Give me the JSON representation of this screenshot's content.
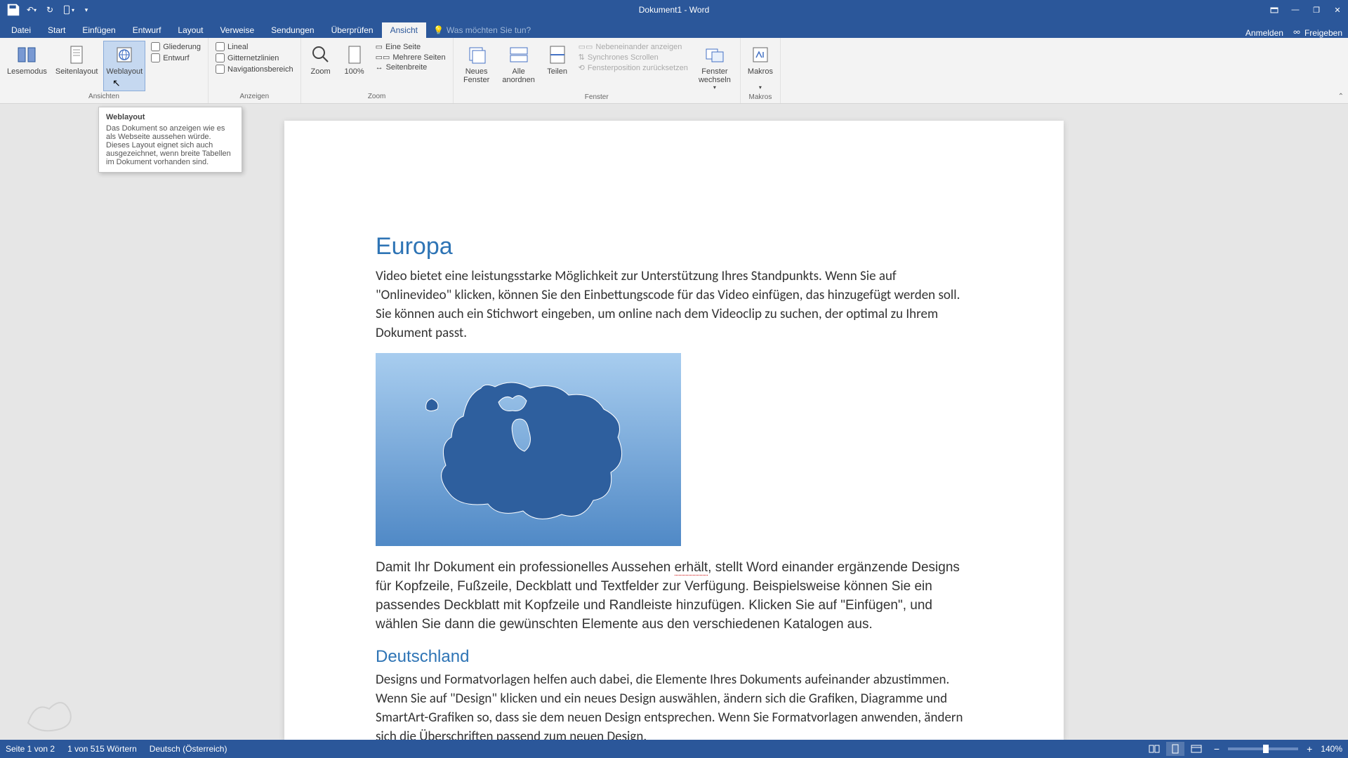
{
  "title": "Dokument1 - Word",
  "qat": {
    "save": "save",
    "undo": "undo",
    "redo": "redo"
  },
  "tabs": {
    "datei": "Datei",
    "start": "Start",
    "einfuegen": "Einfügen",
    "entwurf": "Entwurf",
    "layout": "Layout",
    "verweise": "Verweise",
    "sendungen": "Sendungen",
    "ueberpruefen": "Überprüfen",
    "ansicht": "Ansicht",
    "tellme": "Was möchten Sie tun?",
    "anmelden": "Anmelden",
    "freigeben": "Freigeben"
  },
  "ribbon": {
    "ansichten": {
      "label": "Ansichten",
      "lesemodus": "Lesemodus",
      "seitenlayout": "Seitenlayout",
      "weblayout": "Weblayout",
      "gliederung": "Gliederung",
      "entwurf": "Entwurf"
    },
    "anzeigen": {
      "label": "Anzeigen",
      "lineal": "Lineal",
      "gitternetz": "Gitternetzlinien",
      "navigation": "Navigationsbereich"
    },
    "zoom": {
      "label": "Zoom",
      "zoom": "Zoom",
      "hundred": "100%",
      "eine_seite": "Eine Seite",
      "mehrere": "Mehrere Seiten",
      "breite": "Seitenbreite"
    },
    "fenster": {
      "label": "Fenster",
      "neues": "Neues Fenster",
      "alle": "Alle anordnen",
      "teilen": "Teilen",
      "nebeneinander": "Nebeneinander anzeigen",
      "synchron": "Synchrones Scrollen",
      "position": "Fensterposition zurücksetzen",
      "wechseln": "Fenster wechseln"
    },
    "makros": {
      "label": "Makros",
      "makros": "Makros"
    }
  },
  "tooltip": {
    "title": "Weblayout",
    "body": "Das Dokument so anzeigen wie es als Webseite aussehen würde. Dieses Layout eignet sich auch ausgezeichnet, wenn breite Tabellen im Dokument vorhanden sind."
  },
  "document": {
    "h1": "Europa",
    "p1": "Video bietet eine leistungsstarke Möglichkeit zur Unterstützung Ihres Standpunkts. Wenn Sie auf \"Onlinevideo\" klicken, können Sie den Einbettungscode für das Video einfügen, das hinzugefügt werden soll. Sie können auch ein Stichwort eingeben, um online nach dem Videoclip zu suchen, der optimal zu Ihrem Dokument passt.",
    "p2a": "Damit Ihr Dokument ein professionelles Aussehen ",
    "p2err": "erhält",
    "p2b": ", stellt Word einander ergänzende Designs für Kopfzeile, Fußzeile, Deckblatt und Textfelder zur Verfügung. Beispielsweise können Sie ein passendes Deckblatt mit Kopfzeile und Randleiste hinzufügen. Klicken Sie auf \"Einfügen\", und wählen Sie dann die gewünschten Elemente aus den verschiedenen Katalogen aus.",
    "h2": "Deutschland",
    "p3": "Designs und Formatvorlagen helfen auch dabei, die Elemente Ihres Dokuments aufeinander abzustimmen. Wenn Sie auf \"Design\" klicken und ein neues Design auswählen, ändern sich die Grafiken, Diagramme und SmartArt-Grafiken so, dass sie dem neuen Design entsprechen. Wenn Sie Formatvorlagen anwenden, ändern sich die Überschriften passend zum neuen Design."
  },
  "status": {
    "page": "Seite 1 von 2",
    "words": "1 von 515 Wörtern",
    "lang": "Deutsch (Österreich)",
    "zoom": "140%"
  }
}
